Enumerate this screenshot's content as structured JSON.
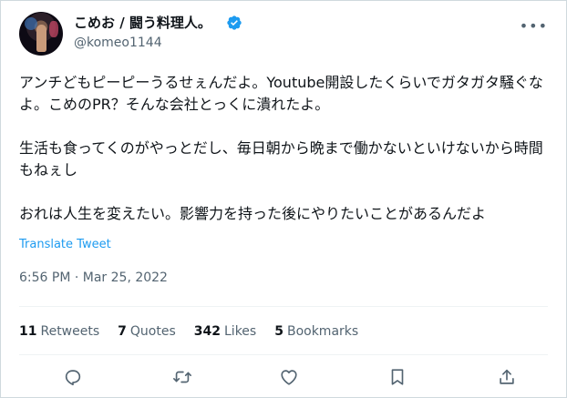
{
  "author": {
    "name": "こめお / 闘う料理人。",
    "handle": "@komeo1144"
  },
  "tweet": {
    "paragraphs": [
      "アンチどもピーピーうるせぇんだよ。Youtube開設したくらいでガタガタ騒ぐなよ。こめのPR？そんな会社とっくに潰れたよ。",
      "生活も食ってくのがやっとだし、毎日朝から晩まで働かないといけないから時間もねぇし",
      "おれは人生を変えたい。影響力を持った後にやりたいことがあるんだよ"
    ],
    "translate_label": "Translate Tweet",
    "timestamp": "6:56 PM · Mar 25, 2022"
  },
  "stats": {
    "retweets_count": "11",
    "retweets_label": "Retweets",
    "quotes_count": "7",
    "quotes_label": "Quotes",
    "likes_count": "342",
    "likes_label": "Likes",
    "bookmarks_count": "5",
    "bookmarks_label": "Bookmarks"
  },
  "colors": {
    "accent": "#1d9bf0",
    "secondary_text": "#536471"
  },
  "icons": [
    "verified-badge-icon",
    "more-icon",
    "reply-icon",
    "retweet-icon",
    "like-icon",
    "bookmark-icon",
    "share-icon"
  ]
}
